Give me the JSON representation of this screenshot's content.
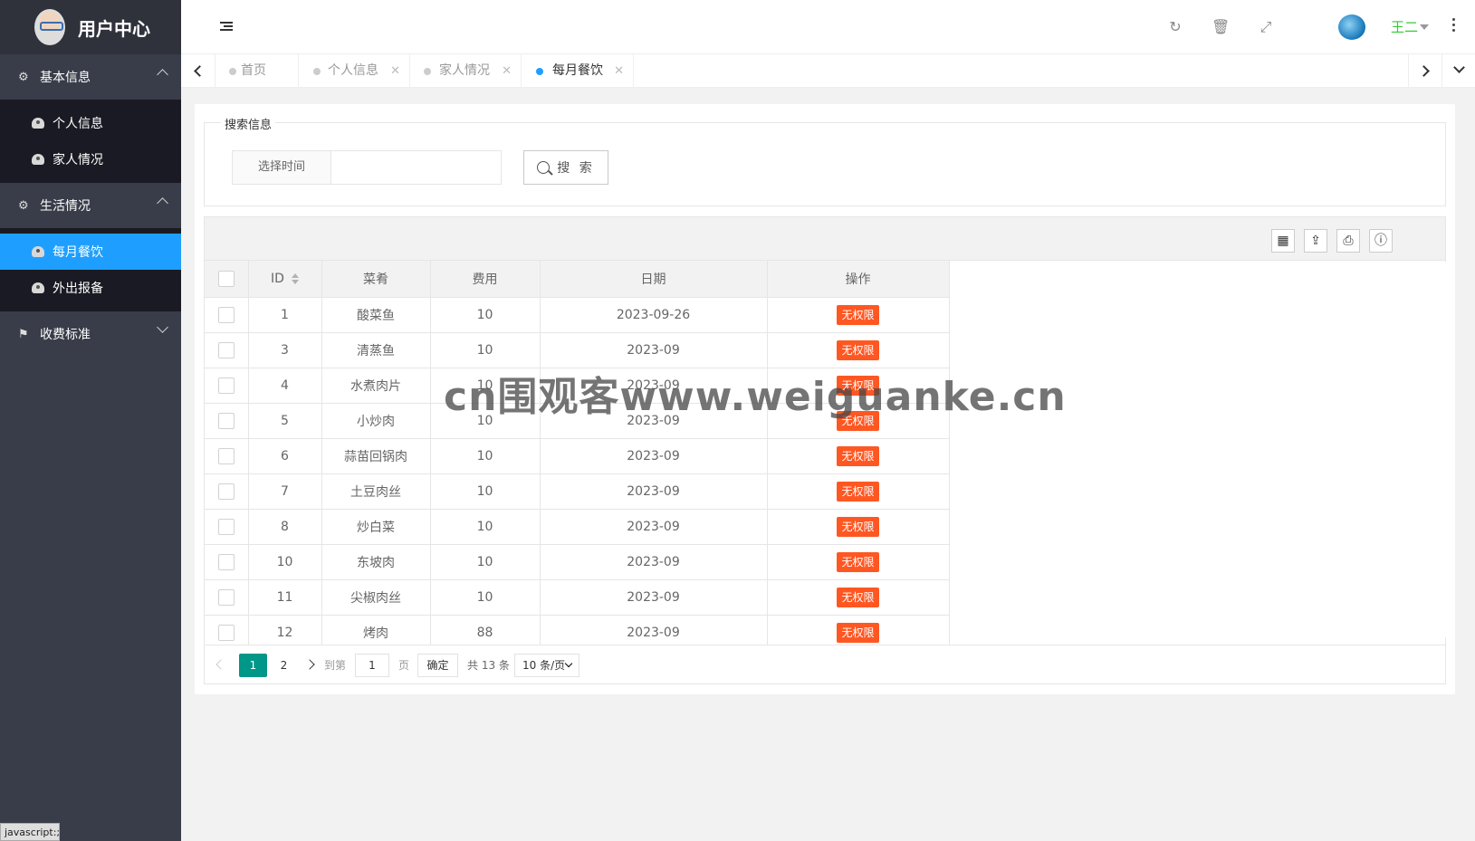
{
  "app": {
    "title": "用户中心"
  },
  "sidebar": {
    "groups": [
      {
        "label": "基本信息",
        "items": [
          {
            "label": "个人信息"
          },
          {
            "label": "家人情况"
          }
        ]
      },
      {
        "label": "生活情况",
        "items": [
          {
            "label": "每月餐饮",
            "active": true
          },
          {
            "label": "外出报备"
          }
        ]
      },
      {
        "label": "收费标准",
        "items": []
      }
    ]
  },
  "header": {
    "icons": [
      "refresh-icon",
      "trash-icon",
      "fullscreen-icon",
      "more-vertical-icon"
    ],
    "user_name": "王二"
  },
  "tabs": [
    {
      "label": "首页"
    },
    {
      "label": "个人信息",
      "closable": true
    },
    {
      "label": "家人情况",
      "closable": true
    },
    {
      "label": "每月餐饮",
      "closable": true,
      "active": true
    }
  ],
  "search": {
    "legend": "搜索信息",
    "field_label": "选择时间",
    "field_value": "",
    "button_label": "搜 索"
  },
  "table": {
    "toolbar_icons": [
      "columns-icon",
      "export-icon",
      "print-icon",
      "info-icon"
    ],
    "columns": [
      "ID",
      "菜肴",
      "费用",
      "日期",
      "操作"
    ],
    "rows": [
      {
        "id": "1",
        "dish": "酸菜鱼",
        "cost": "10",
        "date": "2023-09-26",
        "action": "无权限"
      },
      {
        "id": "3",
        "dish": "清蒸鱼",
        "cost": "10",
        "date": "2023-09",
        "action": "无权限"
      },
      {
        "id": "4",
        "dish": "水煮肉片",
        "cost": "10",
        "date": "2023-09",
        "action": "无权限"
      },
      {
        "id": "5",
        "dish": "小炒肉",
        "cost": "10",
        "date": "2023-09",
        "action": "无权限"
      },
      {
        "id": "6",
        "dish": "蒜苗回锅肉",
        "cost": "10",
        "date": "2023-09",
        "action": "无权限"
      },
      {
        "id": "7",
        "dish": "土豆肉丝",
        "cost": "10",
        "date": "2023-09",
        "action": "无权限"
      },
      {
        "id": "8",
        "dish": "炒白菜",
        "cost": "10",
        "date": "2023-09",
        "action": "无权限"
      },
      {
        "id": "10",
        "dish": "东坡肉",
        "cost": "10",
        "date": "2023-09",
        "action": "无权限"
      },
      {
        "id": "11",
        "dish": "尖椒肉丝",
        "cost": "10",
        "date": "2023-09",
        "action": "无权限"
      },
      {
        "id": "12",
        "dish": "烤肉",
        "cost": "88",
        "date": "2023-09",
        "action": "无权限"
      }
    ],
    "action_color": "#ff5722"
  },
  "pager": {
    "pages": [
      "1",
      "2"
    ],
    "current": "1",
    "goto_prefix": "到第",
    "goto_value": "1",
    "goto_suffix": "页",
    "confirm": "确定",
    "total": "共 13 条",
    "page_size": "10 条/页"
  },
  "status_bar": {
    "text": "javascript:;"
  },
  "watermark": {
    "text": "cn围观客www.weiguanke.cn"
  },
  "colors": {
    "accent": "#1e9fff",
    "sidebar_bg": "#393d49",
    "page_active": "#009688",
    "user_name": "#33cc33"
  }
}
